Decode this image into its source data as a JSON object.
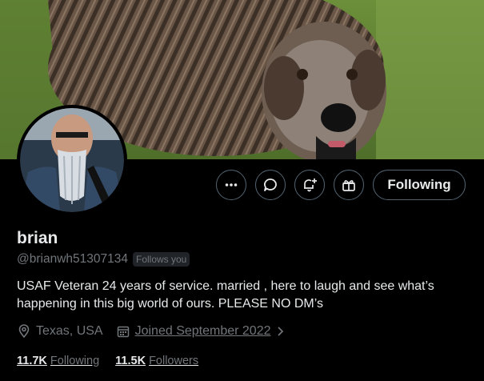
{
  "profile": {
    "name": "brian",
    "handle": "@brianwh51307134",
    "follows_you_badge": "Follows you",
    "bio": "USAF Veteran 24 years of service. married , here to laugh and see what’s happening in this big world of ours. PLEASE NO DM’s",
    "location": "Texas, USA",
    "joined": "Joined September 2022",
    "following_count": "11.7K",
    "following_label": "Following",
    "followers_count": "11.5K",
    "followers_label": "Followers"
  },
  "actions": {
    "follow_button_label": "Following",
    "more_icon": "more-horizontal-icon",
    "message_icon": "message-bubble-icon",
    "notify_icon": "bell-plus-icon",
    "gift_icon": "gift-icon"
  },
  "banner": {
    "subject": "brindle-dog-on-grass"
  },
  "avatar": {
    "subject": "man-with-long-gray-beard"
  },
  "colors": {
    "background": "#000000",
    "text_primary": "#e7e9ea",
    "text_secondary": "#71767b",
    "button_border": "#536471"
  }
}
